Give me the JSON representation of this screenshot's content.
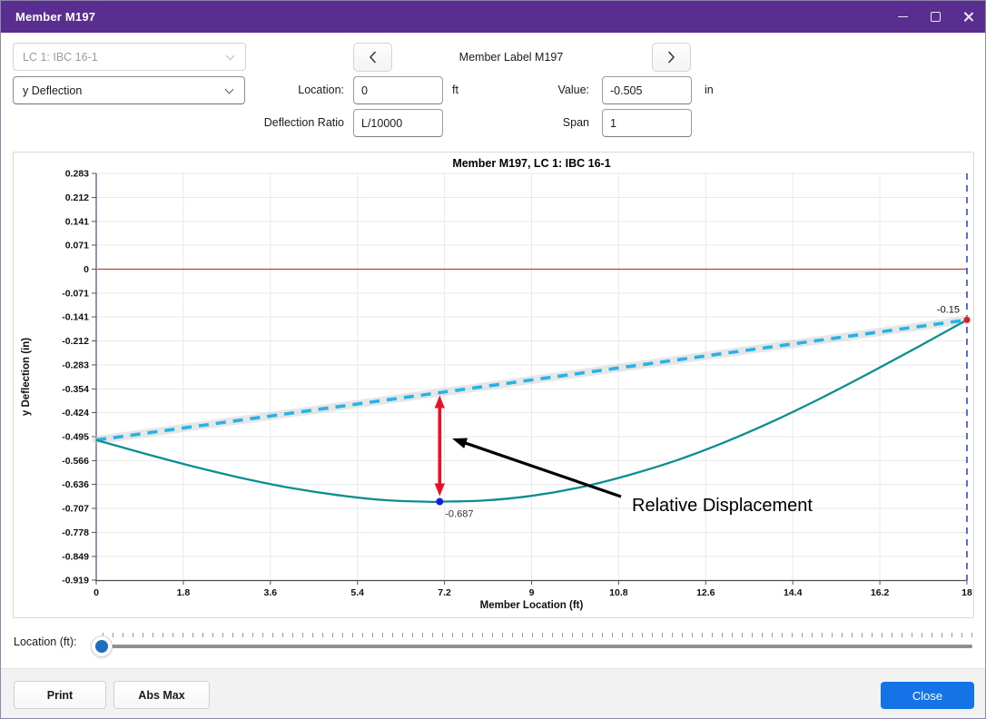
{
  "colors": {
    "titlebar": "#5a2d91",
    "accent_blue": "#1473e6",
    "slider_thumb_blue": "#1b6ec2",
    "curve_teal": "#0d8e8e",
    "chord_cyan": "#27b2e8",
    "zero_line_red": "#c24040",
    "boundary_blue": "#3348cf",
    "arrow_red": "#e81123",
    "min_marker_blue": "#1a1adf",
    "end_marker_red": "#e02020"
  },
  "window": {
    "title": "Member M197"
  },
  "toolbar": {
    "load_combo": {
      "value": "LC 1: IBC 16-1",
      "disabled": true
    },
    "plot_type": {
      "value": "y Deflection"
    },
    "member_label": "Member Label M197",
    "location": {
      "label": "Location:",
      "value": "0",
      "unit": "ft"
    },
    "value": {
      "label": "Value:",
      "value": "-0.505",
      "unit": "in"
    },
    "deflection_ratio": {
      "label": "Deflection Ratio",
      "value": "L/10000"
    },
    "span": {
      "label": "Span",
      "value": "1"
    }
  },
  "chart_data": {
    "type": "line",
    "title": "Member M197, LC 1: IBC 16-1",
    "xlabel": "Member Location (ft)",
    "ylabel": "y Deflection (in)",
    "xlim": [
      0,
      18
    ],
    "ylim": [
      -0.919,
      0.283
    ],
    "grid": true,
    "x_ticks": [
      "0",
      "1.8",
      "3.6",
      "5.4",
      "7.2",
      "9",
      "10.8",
      "12.6",
      "14.4",
      "16.2",
      "18"
    ],
    "y_ticks": [
      "0.283",
      "0.212",
      "0.141",
      "0.071",
      "0",
      "-0.071",
      "-0.141",
      "-0.212",
      "-0.283",
      "-0.354",
      "-0.424",
      "-0.495",
      "-0.566",
      "-0.636",
      "-0.707",
      "-0.778",
      "-0.849",
      "-0.919"
    ],
    "series": [
      {
        "name": "y Deflection curve",
        "style": "solid",
        "color": "#0d8e8e",
        "x": [
          0,
          1,
          2,
          3,
          4,
          5,
          6,
          7,
          7.1,
          8,
          9,
          10,
          11,
          12,
          13,
          14,
          15,
          16,
          17,
          18
        ],
        "y": [
          -0.505,
          -0.545,
          -0.583,
          -0.617,
          -0.646,
          -0.668,
          -0.683,
          -0.688,
          -0.687,
          -0.684,
          -0.67,
          -0.645,
          -0.609,
          -0.565,
          -0.511,
          -0.449,
          -0.38,
          -0.306,
          -0.229,
          -0.15
        ]
      },
      {
        "name": "Chord between member ends",
        "style": "dashed",
        "color": "#27b2e8",
        "x": [
          0,
          18
        ],
        "y": [
          -0.505,
          -0.15
        ]
      }
    ],
    "zero_line": {
      "y": 0,
      "color": "#c24040"
    },
    "boundary_line": {
      "x": 18,
      "style": "dashed",
      "color": "#3348cf"
    },
    "markers": [
      {
        "name": "min-deflection-point",
        "x": 7.1,
        "y": -0.687,
        "label": "-0.687",
        "color": "#1a1adf"
      },
      {
        "name": "end-deflection-point",
        "x": 18,
        "y": -0.15,
        "label": "-0.15",
        "color": "#e02020"
      }
    ],
    "relative_displacement_arrow": {
      "x": 7.1,
      "from": "chord",
      "to": -0.687,
      "color": "#e81123"
    },
    "annotation": {
      "text": "Relative Displacement"
    }
  },
  "slider": {
    "label": "Location (ft):",
    "value": 0,
    "min": 0,
    "max": 18
  },
  "footer": {
    "print_label": "Print",
    "abs_max_label": "Abs Max",
    "close_label": "Close"
  }
}
